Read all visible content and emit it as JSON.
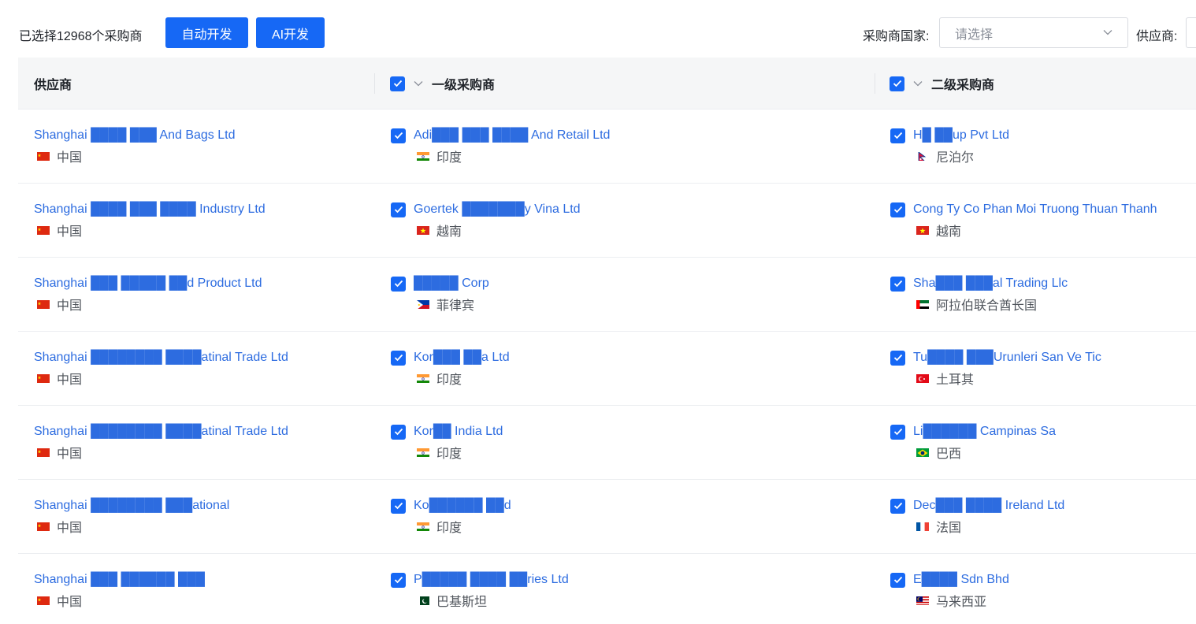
{
  "toolbar": {
    "selected_text": "已选择12968个采购商",
    "auto_dev_label": "自动开发",
    "ai_dev_label": "AI开发",
    "country_filter_label": "采购商国家:",
    "country_filter_placeholder": "请选择",
    "supplier_filter_label": "供应商:"
  },
  "table": {
    "headers": {
      "supplier": "供应商",
      "level1": "一级采购商",
      "level2": "二级采购商"
    },
    "rows": [
      {
        "supplier": {
          "name": "Shanghai ████ ███ And Bags Ltd",
          "country": "中国",
          "flag": "cn"
        },
        "level1": {
          "name": "Adi███ ███ ████ And Retail Ltd",
          "country": "印度",
          "flag": "in"
        },
        "level2": {
          "name": "H█ ██up Pvt Ltd",
          "country": "尼泊尔",
          "flag": "np"
        }
      },
      {
        "supplier": {
          "name": "Shanghai ████ ███ ████ Industry Ltd",
          "country": "中国",
          "flag": "cn"
        },
        "level1": {
          "name": "Goertek ███████y Vina Ltd",
          "country": "越南",
          "flag": "vn"
        },
        "level2": {
          "name": "Cong Ty Co Phan Moi Truong Thuan Thanh",
          "country": "越南",
          "flag": "vn"
        }
      },
      {
        "supplier": {
          "name": "Shanghai ███ █████ ██d Product Ltd",
          "country": "中国",
          "flag": "cn"
        },
        "level1": {
          "name": "█████ Corp",
          "country": "菲律宾",
          "flag": "ph"
        },
        "level2": {
          "name": "Sha███ ███al Trading Llc",
          "country": "阿拉伯联合酋长国",
          "flag": "ae"
        }
      },
      {
        "supplier": {
          "name": "Shanghai ████████ ████atinal Trade Ltd",
          "country": "中国",
          "flag": "cn"
        },
        "level1": {
          "name": "Kor███ ██a Ltd",
          "country": "印度",
          "flag": "in"
        },
        "level2": {
          "name": "Tu████ ███Urunleri San Ve Tic",
          "country": "土耳其",
          "flag": "tr"
        }
      },
      {
        "supplier": {
          "name": "Shanghai ████████ ████atinal Trade Ltd",
          "country": "中国",
          "flag": "cn"
        },
        "level1": {
          "name": "Kor██ India Ltd",
          "country": "印度",
          "flag": "in"
        },
        "level2": {
          "name": "Li██████ Campinas Sa",
          "country": "巴西",
          "flag": "br"
        }
      },
      {
        "supplier": {
          "name": "Shanghai ████████ ███ational",
          "country": "中国",
          "flag": "cn"
        },
        "level1": {
          "name": "Ko██████ ██d",
          "country": "印度",
          "flag": "in"
        },
        "level2": {
          "name": "Dec███ ████ Ireland Ltd",
          "country": "法国",
          "flag": "fr"
        }
      },
      {
        "supplier": {
          "name": "Shanghai ███ ██████ ███",
          "country": "中国",
          "flag": "cn"
        },
        "level1": {
          "name": "P█████ ████ ██ries Ltd",
          "country": "巴基斯坦",
          "flag": "pk"
        },
        "level2": {
          "name": "E████ Sdn Bhd",
          "country": "马来西亚",
          "flag": "my"
        }
      }
    ]
  },
  "colors": {
    "accent": "#1668f5",
    "link": "#2d6ce0",
    "header_bg": "#f5f6f7"
  }
}
